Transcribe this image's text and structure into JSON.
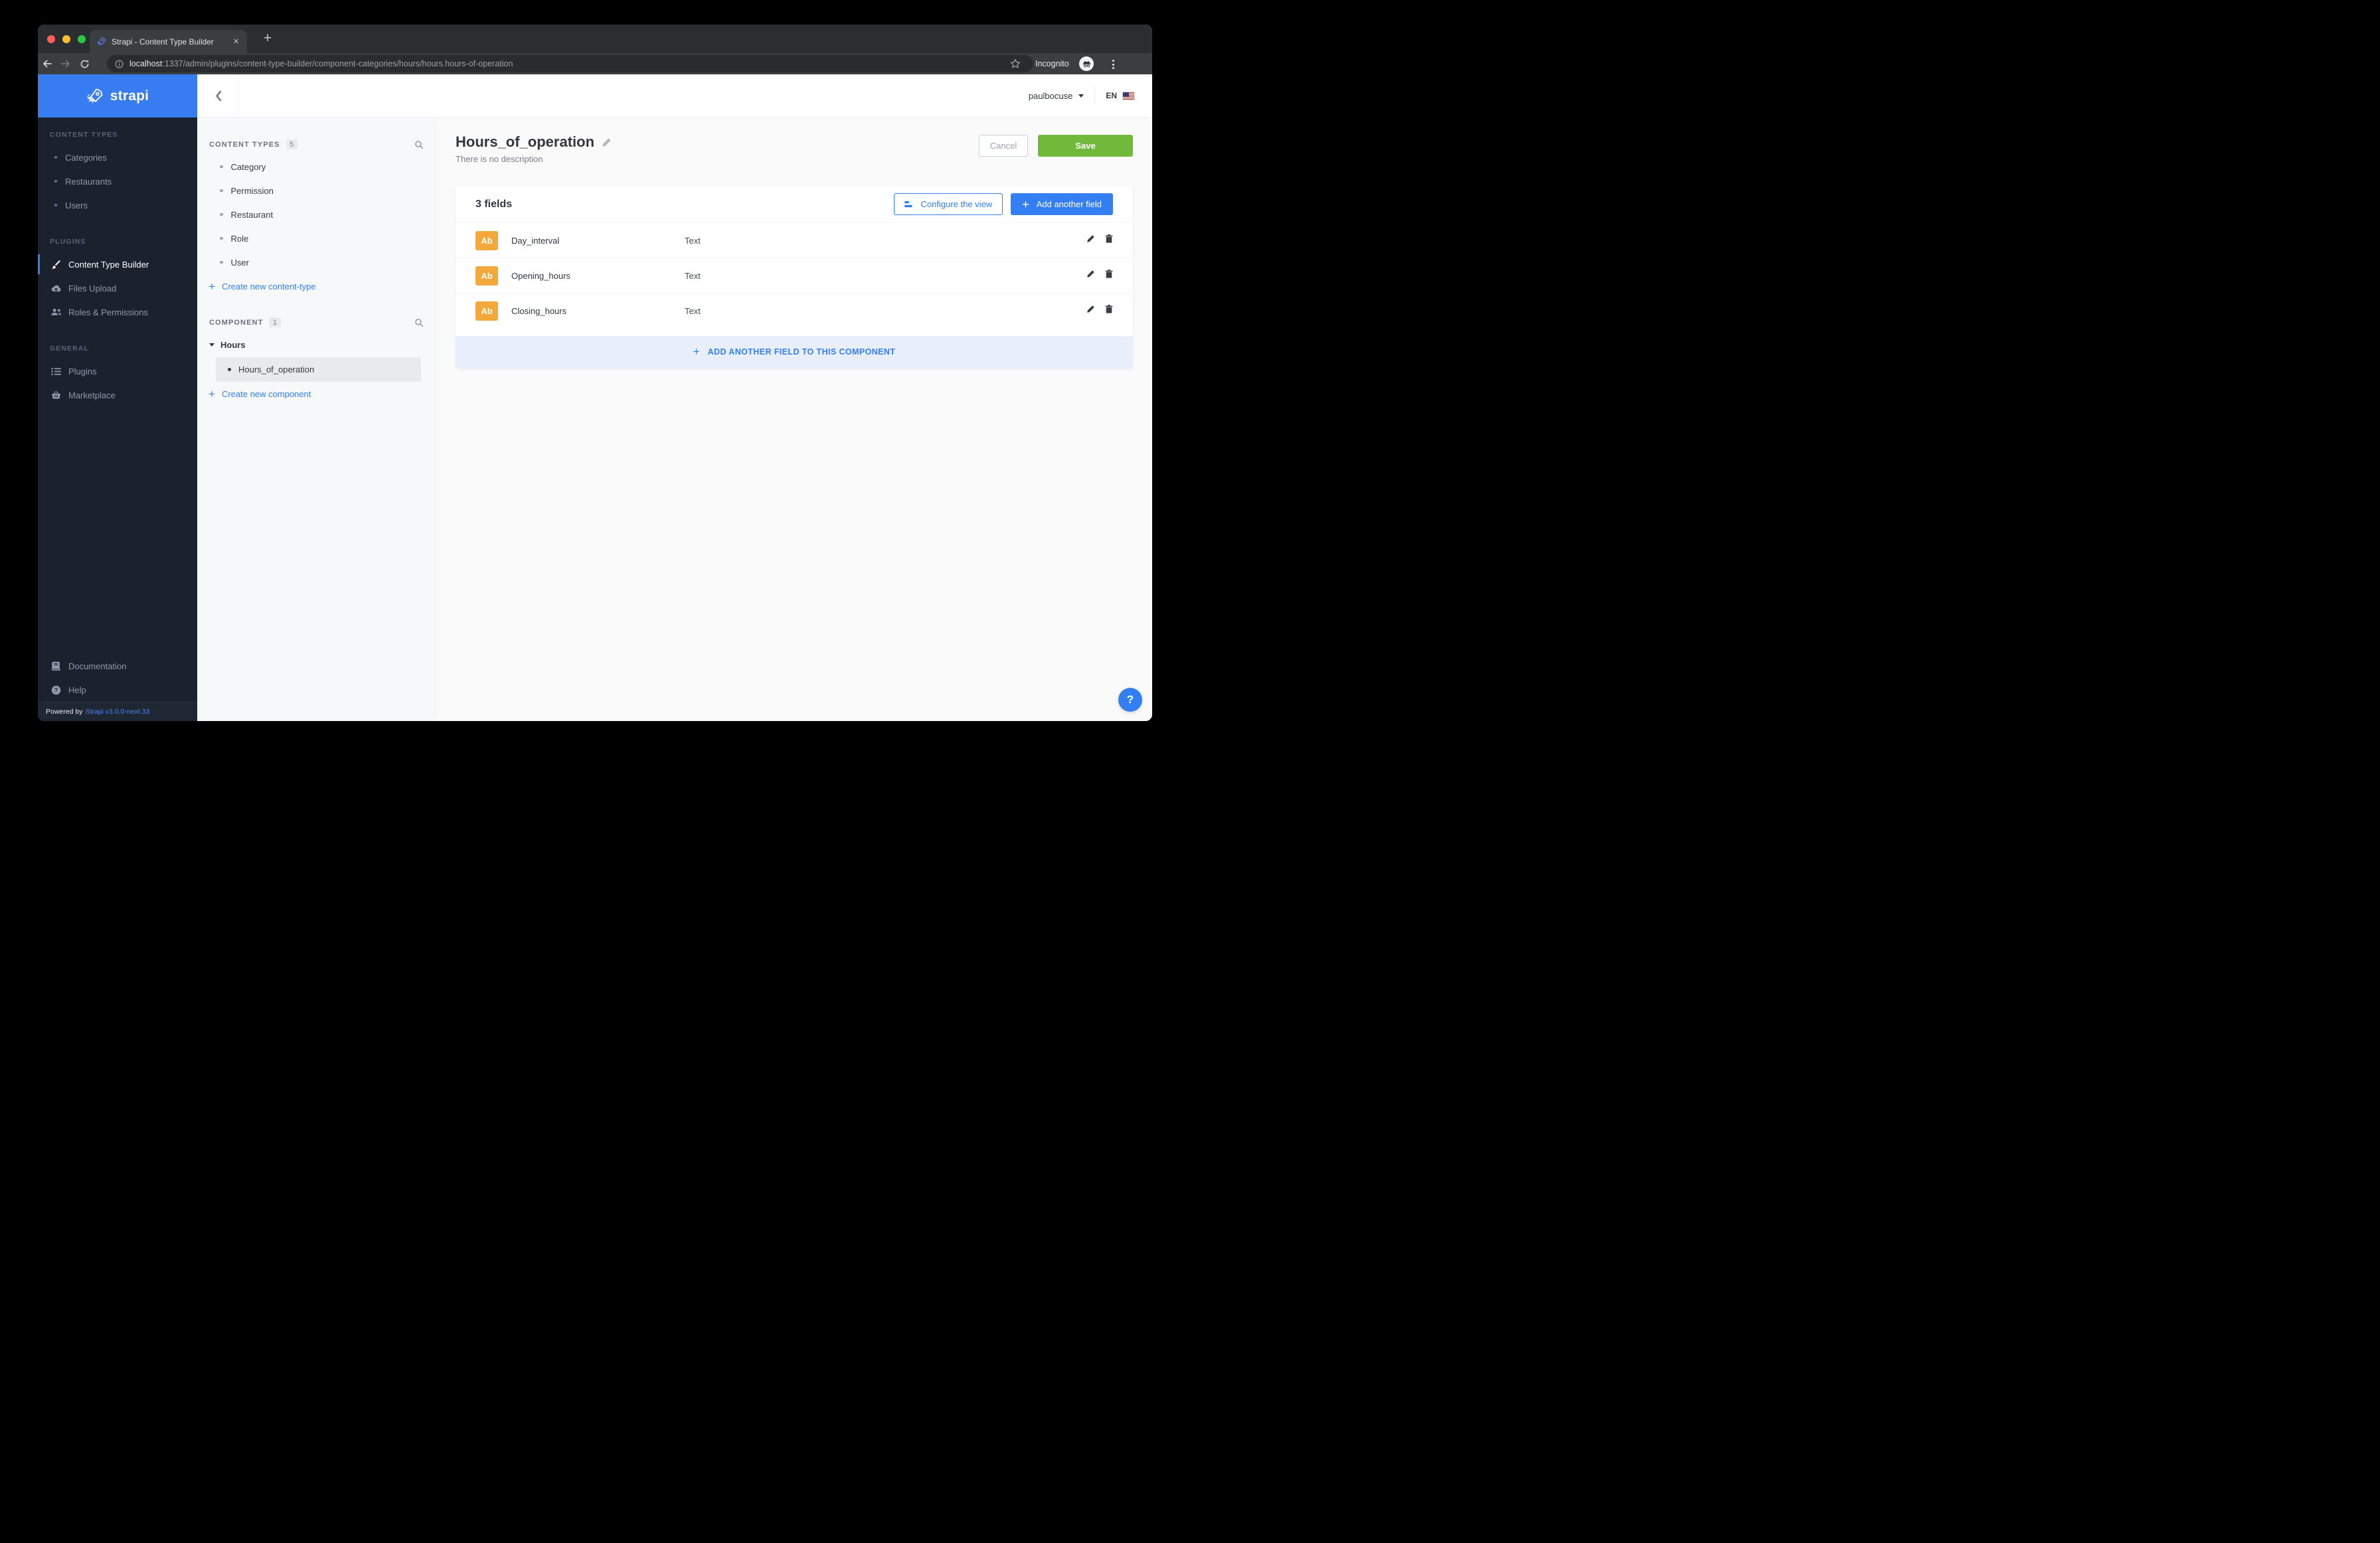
{
  "browser": {
    "tab_title": "Strapi - Content Type Builder",
    "url_host": "localhost",
    "url_path": ":1337/admin/plugins/content-type-builder/component-categories/hours/hours.hours-of-operation",
    "incognito": "Incognito"
  },
  "header": {
    "brand": "strapi",
    "user": "paulbocuse",
    "locale": "EN"
  },
  "nav": {
    "sections": [
      {
        "label": "CONTENT TYPES",
        "items": [
          "Categories",
          "Restaurants",
          "Users"
        ]
      },
      {
        "label": "PLUGINS",
        "items": [
          "Content Type Builder",
          "Files Upload",
          "Roles & Permissions"
        ]
      },
      {
        "label": "GENERAL",
        "items": [
          "Plugins",
          "Marketplace"
        ]
      }
    ],
    "footer_items": [
      "Documentation",
      "Help"
    ],
    "powered_by": "Powered by",
    "version": "Strapi v3.0.0-next.33"
  },
  "subnav": {
    "content_types": {
      "label": "CONTENT TYPES",
      "count": "5",
      "items": [
        "Category",
        "Permission",
        "Restaurant",
        "Role",
        "User"
      ],
      "create": "Create new content-type"
    },
    "components": {
      "label": "COMPONENT",
      "count": "1",
      "group": "Hours",
      "selected": "Hours_of_operation",
      "create": "Create new component"
    }
  },
  "main": {
    "title": "Hours_of_operation",
    "subtitle": "There is no description",
    "cancel": "Cancel",
    "save": "Save",
    "fields_count": "3 fields",
    "configure_view": "Configure the view",
    "add_field": "Add another field",
    "rows": [
      {
        "badge": "Ab",
        "name": "Day_interval",
        "type": "Text"
      },
      {
        "badge": "Ab",
        "name": "Opening_hours",
        "type": "Text"
      },
      {
        "badge": "Ab",
        "name": "Closing_hours",
        "type": "Text"
      }
    ],
    "add_field_footer": "ADD ANOTHER FIELD TO THIS COMPONENT",
    "help": "?"
  },
  "glyphs": {
    "plus": "+",
    "close": "×"
  },
  "colors": {
    "accent_blue": "#337EF3",
    "save_green": "#70B93B",
    "field_badge_orange": "#F3A83B",
    "sidebar_dark": "#1B222E",
    "footer_band_blue": "#E8EEFA"
  }
}
